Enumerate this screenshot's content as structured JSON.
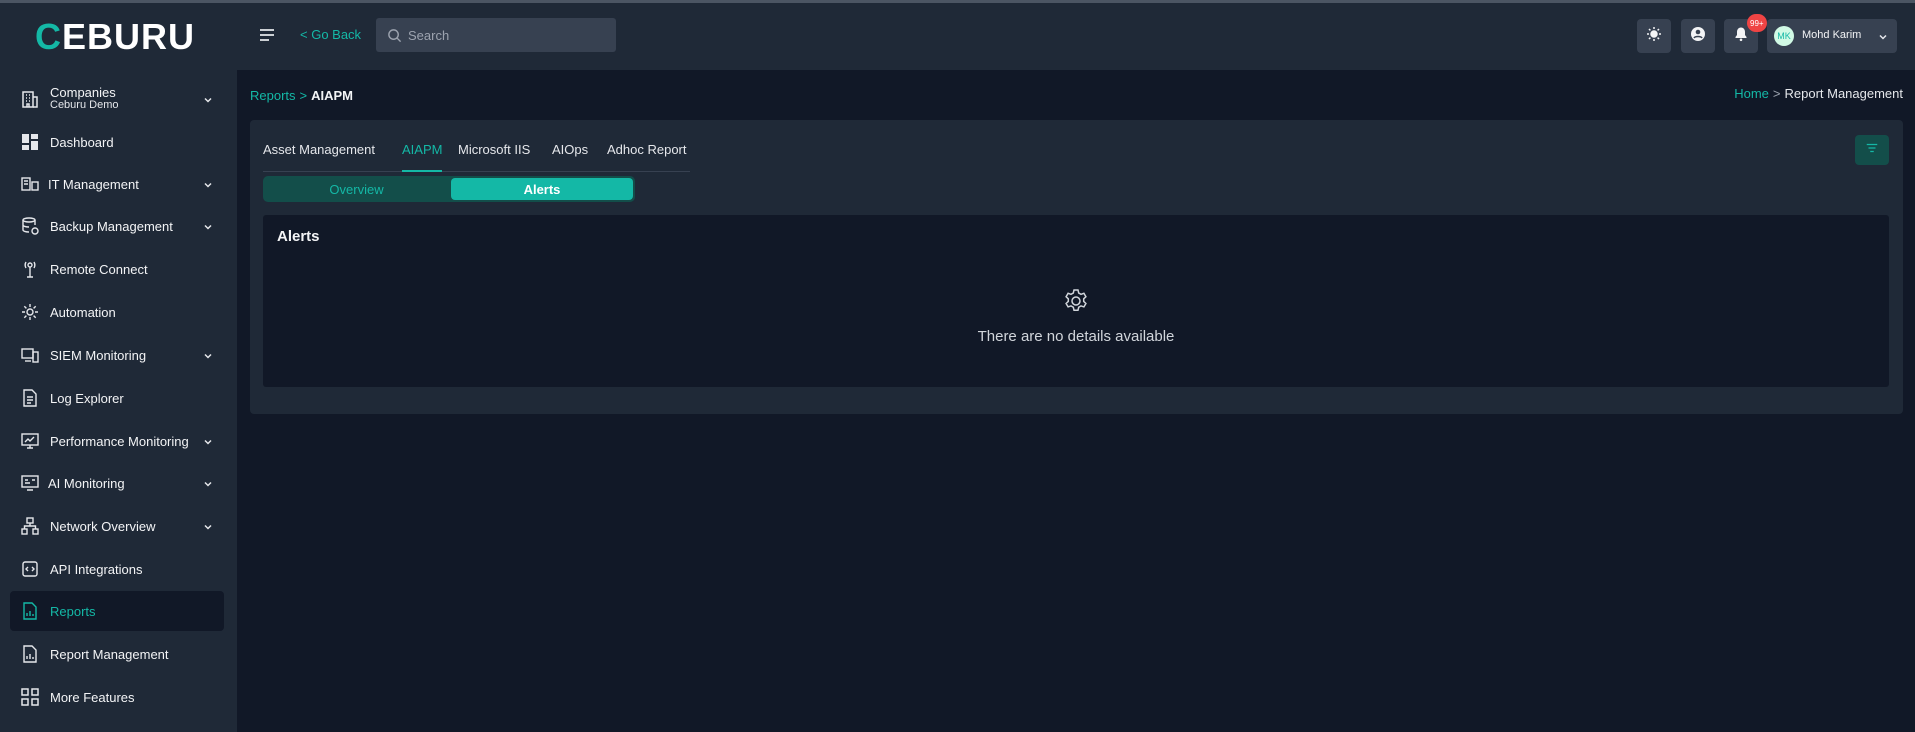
{
  "app": {
    "logo_rest": "EBURU",
    "logo_first": "C"
  },
  "header": {
    "go_back": "< Go Back",
    "search_placeholder": "Search",
    "notification_count": "99+",
    "user": {
      "initials": "MK",
      "name": "Mohd Karim"
    }
  },
  "sidebar": {
    "company": {
      "label": "Companies",
      "sub": "Ceburu Demo"
    },
    "items": [
      {
        "label": "Dashboard"
      },
      {
        "label": "IT Management"
      },
      {
        "label": "Backup Management"
      },
      {
        "label": "Remote Connect"
      },
      {
        "label": "Automation"
      },
      {
        "label": "SIEM Monitoring"
      },
      {
        "label": "Log Explorer"
      },
      {
        "label": "Performance Monitoring"
      },
      {
        "label": "AI Monitoring"
      },
      {
        "label": "Network Overview"
      },
      {
        "label": "API Integrations"
      },
      {
        "label": "Reports"
      },
      {
        "label": "Report Management"
      },
      {
        "label": "More Features"
      }
    ]
  },
  "breadcrumb_left": {
    "link": "Reports",
    "sep": ">",
    "current": "AIAPM"
  },
  "breadcrumb_right": {
    "link": "Home",
    "sep": ">",
    "current": "Report Management"
  },
  "tabs": [
    {
      "label": "Asset Management"
    },
    {
      "label": "AIAPM"
    },
    {
      "label": "Microsoft IIS"
    },
    {
      "label": "AIOps"
    },
    {
      "label": "Adhoc Report"
    }
  ],
  "segment": {
    "overview": "Overview",
    "alerts": "Alerts"
  },
  "panel": {
    "title": "Alerts",
    "empty_text": "There are no details available"
  },
  "colors": {
    "accent": "#14b8a6",
    "background": "#111827",
    "surface": "#1f2937",
    "badge": "#ef4444"
  }
}
